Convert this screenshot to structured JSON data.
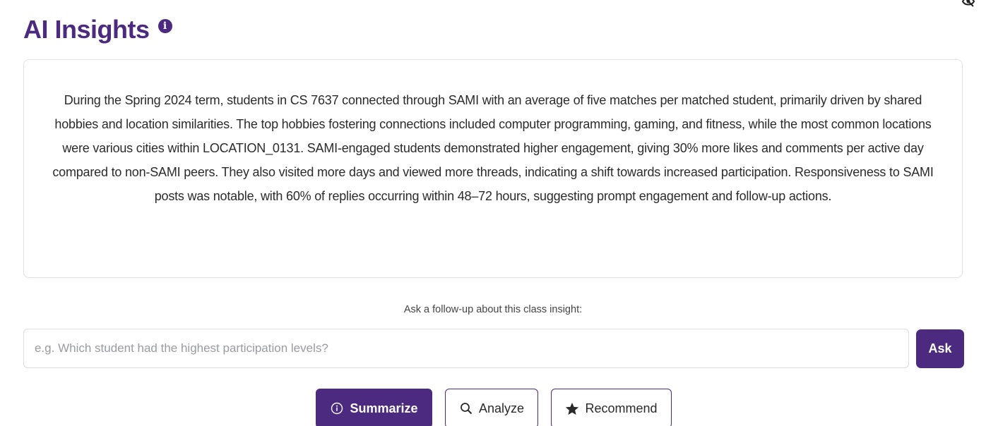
{
  "header": {
    "title": "AI Insights",
    "info_icon": "info-circle-icon",
    "corner_icon": "eye-slash-icon"
  },
  "insight": {
    "text": "During the Spring 2024 term, students in CS 7637 connected through SAMI with an average of five matches per matched student, primarily driven by shared hobbies and location similarities. The top hobbies fostering connections included computer programming, gaming, and fitness, while the most common locations were various cities within LOCATION_0131. SAMI-engaged students demonstrated higher engagement, giving 30% more likes and comments per active day compared to non-SAMI peers. They also visited more days and viewed more threads, indicating a shift towards increased participation. Responsiveness to SAMI posts was notable, with 60% of replies occurring within 48–72 hours, suggesting prompt engagement and follow-up actions."
  },
  "followup": {
    "label": "Ask a follow-up about this class insight:",
    "value": "",
    "placeholder": "e.g. Which student had the highest participation levels?",
    "ask_label": "Ask"
  },
  "actions": [
    {
      "label": "Summarize",
      "icon": "info-circle-outline-icon",
      "active": true
    },
    {
      "label": "Analyze",
      "icon": "search-icon",
      "active": false
    },
    {
      "label": "Recommend",
      "icon": "star-icon",
      "active": false
    }
  ],
  "colors": {
    "accent": "#4b2a7f",
    "text": "#2b2b2b",
    "placeholder": "#9a9aa3",
    "border": "#e3e3e8"
  }
}
